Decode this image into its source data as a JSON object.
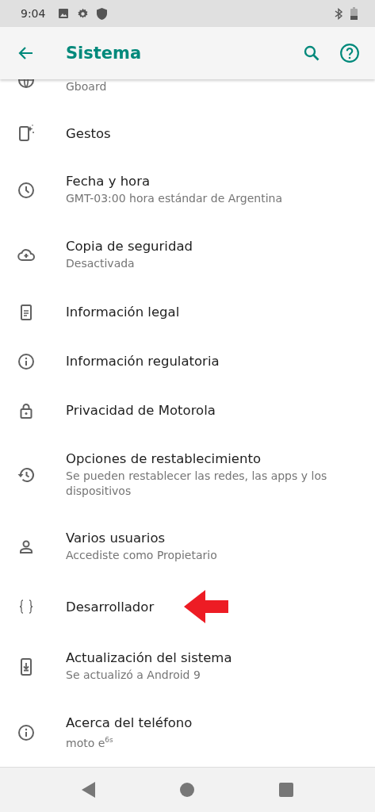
{
  "status_bar": {
    "time": "9:04"
  },
  "app_bar": {
    "title": "Sistema"
  },
  "partial_item": {
    "summary": "Gboard"
  },
  "items": [
    {
      "title": "Gestos",
      "highlighted": false
    },
    {
      "title": "Fecha y hora",
      "summary": "GMT-03:00 hora estándar de Argentina",
      "highlighted": false
    },
    {
      "title": "Copia de seguridad",
      "summary": "Desactivada",
      "highlighted": false
    },
    {
      "title": "Información legal",
      "highlighted": false
    },
    {
      "title": "Información regulatoria",
      "highlighted": false
    },
    {
      "title": "Privacidad de Motorola",
      "highlighted": false
    },
    {
      "title": "Opciones de restablecimiento",
      "summary": "Se pueden restablecer las redes, las apps y los dispositivos",
      "highlighted": false
    },
    {
      "title": "Varios usuarios",
      "summary": "Accediste como Propietario",
      "highlighted": false
    },
    {
      "title": "Desarrollador",
      "highlighted": true
    },
    {
      "title": "Actualización del sistema",
      "summary": "Se actualizó a Android 9",
      "highlighted": false
    },
    {
      "title": "Acerca del teléfono",
      "summary": "moto e$^{6s}$",
      "highlighted": false
    }
  ]
}
